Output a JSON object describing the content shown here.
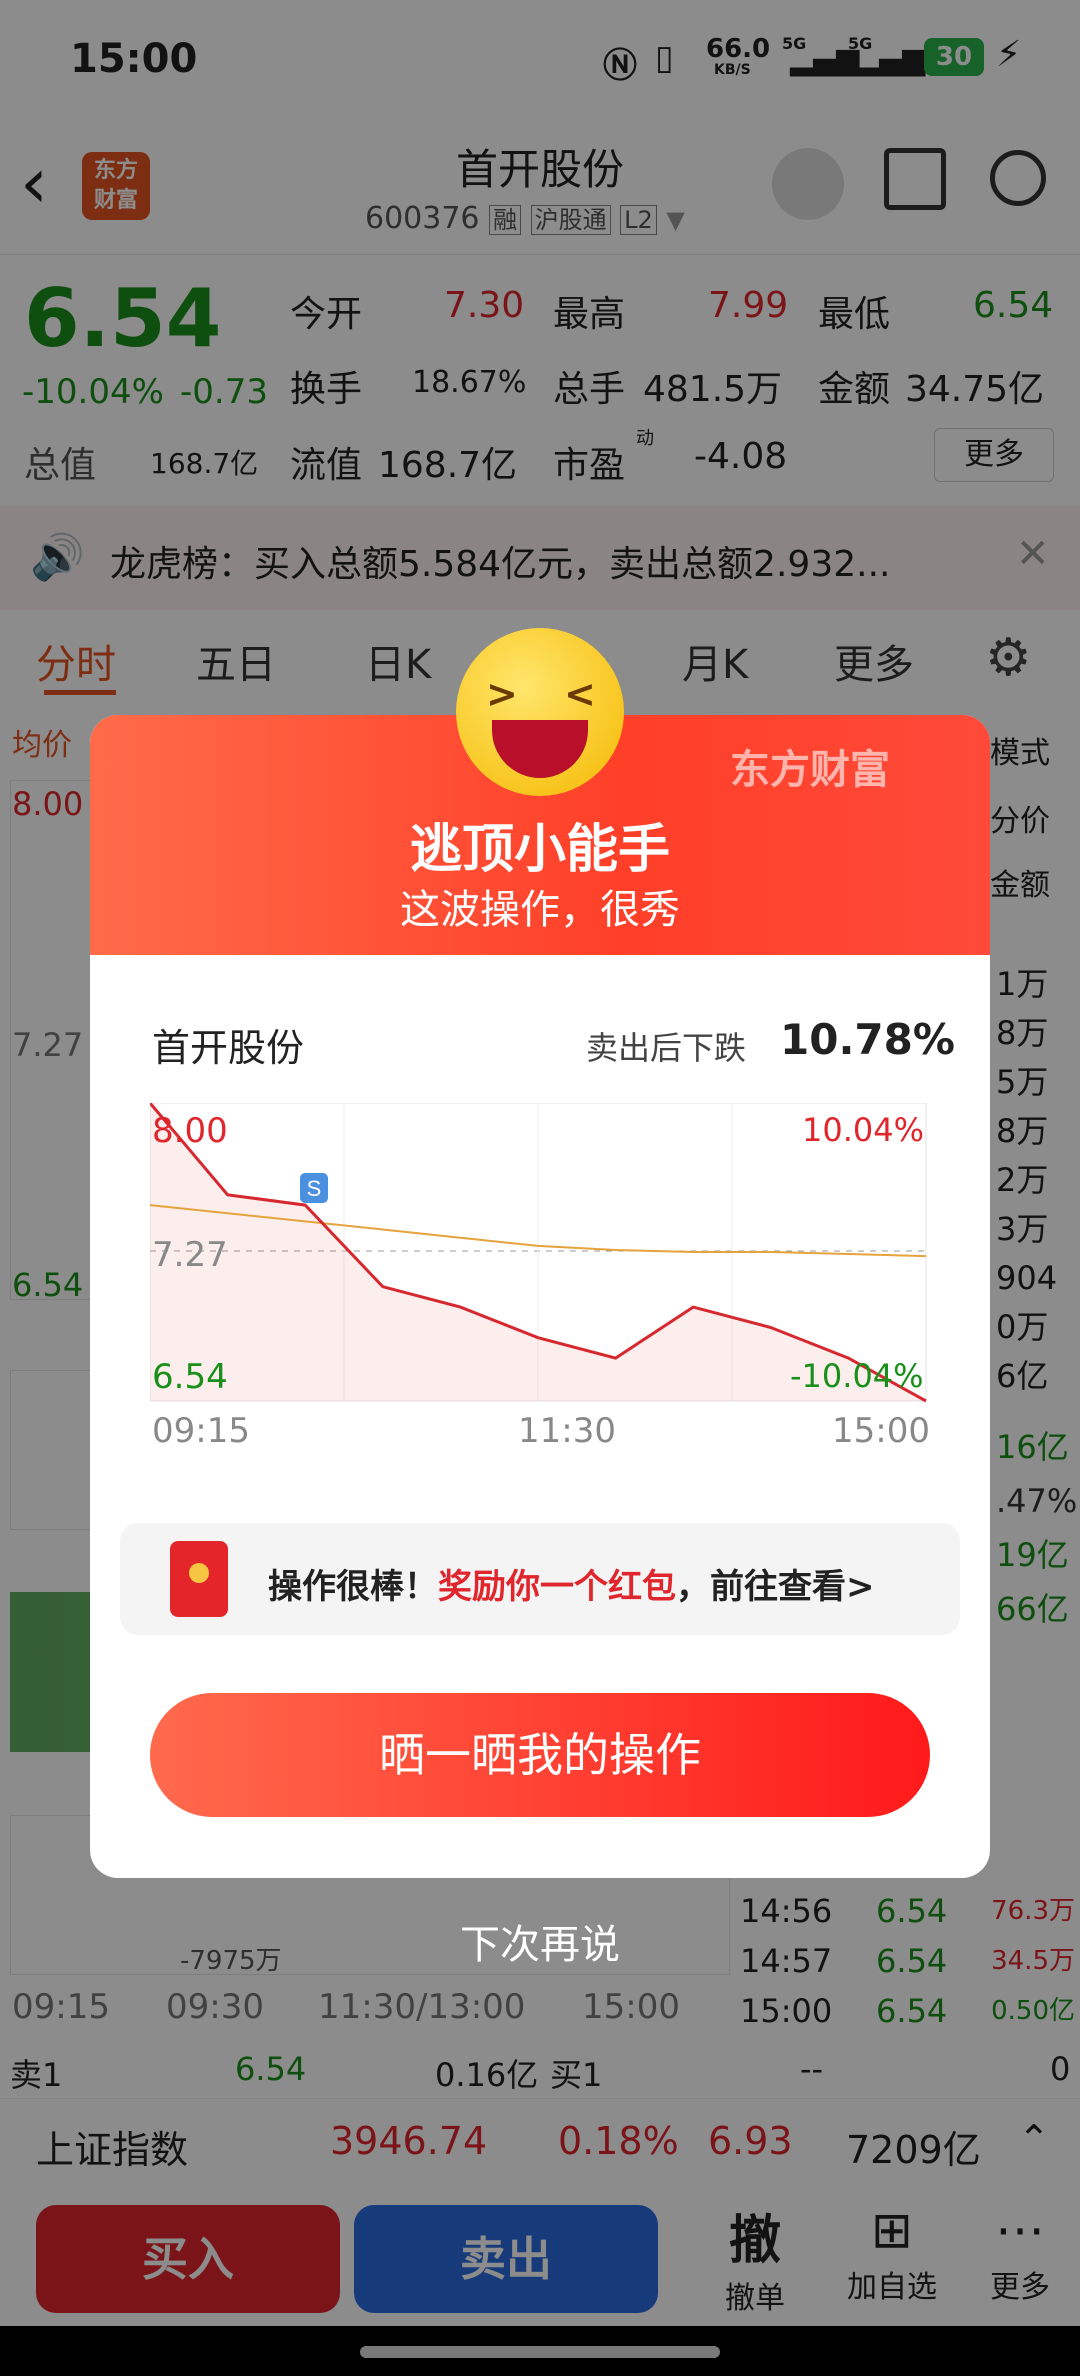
{
  "status_bar": {
    "time": "15:00",
    "speed_value": "66.0",
    "speed_unit": "KB/S",
    "net1": "5G",
    "net2": "5G",
    "battery": "30"
  },
  "header": {
    "logo_line1": "东方",
    "logo_line2": "财富",
    "title": "首开股份",
    "code": "600376",
    "tag1": "融",
    "tag2": "沪股通",
    "tag3": "L2"
  },
  "quote": {
    "price": "6.54",
    "change_pct": "-10.04%",
    "change_amt": "-0.73",
    "open_label": "今开",
    "open": "7.30",
    "high_label": "最高",
    "high": "7.99",
    "low_label": "最低",
    "low": "6.54",
    "turnover_label": "换手",
    "turnover": "18.67%",
    "volume_label": "总手",
    "volume": "481.5万",
    "amount_label": "金额",
    "amount": "34.75亿",
    "mktcap_label": "总值",
    "mktcap": "168.7亿",
    "float_label": "流值",
    "float": "168.7亿",
    "pe_label": "市盈",
    "pe_sup": "动",
    "pe": "-4.08",
    "more_button": "更多"
  },
  "notice": {
    "text": "龙虎榜：买入总额5.584亿元，卖出总额2.932..."
  },
  "tabs": [
    "分时",
    "五日",
    "日K",
    "月K",
    "更多"
  ],
  "chart_bg": {
    "avg_label": "均价",
    "top_price": "8.00",
    "mid_price": "7.27",
    "low_price": "6.54",
    "vol_label": "-7975万",
    "time_labels": [
      "09:15",
      "09:30",
      "11:30/13:00",
      "15:00"
    ],
    "right_labels": {
      "mode": "模式",
      "avgprice": "分价",
      "amount": "金额"
    },
    "right_vals": [
      "1万",
      "8万",
      "5万",
      "8万",
      "2万",
      "3万",
      "904",
      "0万",
      "6亿"
    ],
    "right_vals2": [
      "16亿",
      ".47%",
      "19亿",
      "66亿"
    ],
    "ticks": [
      {
        "time": "14:56",
        "price": "6.54",
        "vol": "76.3万"
      },
      {
        "time": "14:57",
        "price": "6.54",
        "vol": "34.5万"
      },
      {
        "time": "15:00",
        "price": "6.54",
        "vol": "0.50亿"
      }
    ],
    "sell1_label": "卖1",
    "sell1_price": "6.54",
    "sell1_vol": "0.16亿",
    "buy1_label": "买1",
    "buy1_price": "--",
    "buy1_vol": "0"
  },
  "index_bar": {
    "name": "上证指数",
    "value": "3946.74",
    "pct": "0.18%",
    "chg": "6.93",
    "amount": "7209亿"
  },
  "bottom_bar": {
    "buy": "买入",
    "sell": "卖出",
    "cancel_icon": "撤",
    "cancel": "撤单",
    "add": "加自选",
    "more": "更多"
  },
  "modal": {
    "brand": "东方财富",
    "title": "逃顶小能手",
    "subtitle": "这波操作，很秀",
    "stock": "首开股份",
    "drop_label": "卖出后下跌",
    "drop_value": "10.78%",
    "chart_top": "8.00",
    "chart_mid": "7.27",
    "chart_low": "6.54",
    "pct_top": "10.04%",
    "pct_low": "-10.04%",
    "marker": "S",
    "x_labels": [
      "09:15",
      "11:30",
      "15:00"
    ],
    "reward_prefix": "操作很棒！",
    "reward_highlight": "奖励你一个红包",
    "reward_suffix": "，前往查看>",
    "share_button": "晒一晒我的操作",
    "dismiss": "下次再说"
  },
  "chart_data": {
    "type": "line",
    "x": [
      "09:15",
      "09:30",
      "10:00",
      "10:30",
      "11:00",
      "11:30",
      "13:30",
      "14:00",
      "14:20",
      "14:40",
      "15:00"
    ],
    "series": [
      {
        "values": [
          8.0,
          7.55,
          7.5,
          7.1,
          7.0,
          6.85,
          6.75,
          7.0,
          6.9,
          6.75,
          6.54
        ]
      },
      {
        "values": [
          7.5,
          7.46,
          7.42,
          7.38,
          7.34,
          7.3,
          7.28,
          7.27,
          7.27,
          7.26,
          7.25
        ]
      }
    ],
    "ylim": [
      6.54,
      8.0
    ],
    "colors": [
      "#d6282e",
      "#e6a23c"
    ]
  }
}
